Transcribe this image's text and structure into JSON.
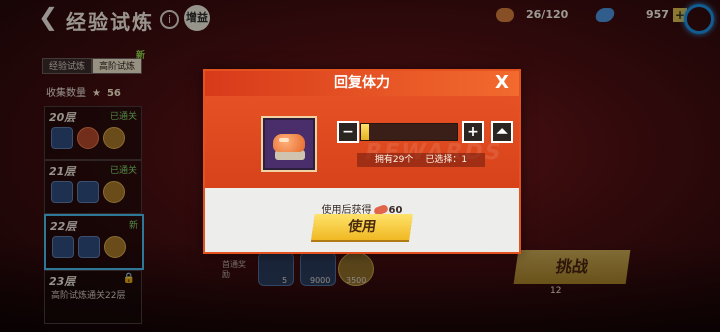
{
  "topbar": {
    "title": "经验试炼",
    "info_icon": "info-icon",
    "boost_label": "增益",
    "stamina": {
      "icon": "sushi-stamina-icon",
      "value": "26/120"
    },
    "gem": {
      "icon": "gem-icon"
    },
    "coin": {
      "value": "957",
      "plus": "+"
    }
  },
  "sidebar": {
    "tabs": [
      {
        "label": "经验试炼"
      },
      {
        "label": "高阶试炼"
      }
    ],
    "new_badge": "新",
    "collect_label": "收集数量",
    "collect_count": "56",
    "levels": [
      {
        "no": "20层",
        "status": "已通关"
      },
      {
        "no": "21层",
        "status": "已通关"
      },
      {
        "no": "22层",
        "status": "新"
      },
      {
        "no": "23层",
        "desc": "高阶试炼通关22层"
      }
    ]
  },
  "background": {
    "reward_label": "首通奖励",
    "rewards": [
      "5",
      "9000",
      "3500"
    ],
    "challenge_label": "挑战",
    "challenge_cost": "12"
  },
  "modal": {
    "title": "回复体力",
    "close": "X",
    "watermark": "REWARDS",
    "minus": "−",
    "plus": "+",
    "max": "⏶",
    "slider_fraction": 0.08,
    "owned_text": "拥有29个",
    "selected_text": "已选择：1",
    "gain_prefix": "使用后获得",
    "gain_value": "60",
    "use_label": "使用"
  },
  "colors": {
    "accent_orange": "#e4531f",
    "button_yellow": "#f0b823",
    "selected_border": "#49b7e6"
  }
}
